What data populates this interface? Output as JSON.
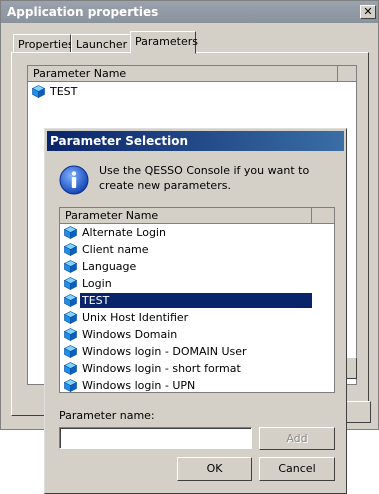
{
  "outer_window": {
    "title": "Application properties",
    "close_glyph": "✕",
    "tabs": [
      {
        "label": "Properties",
        "active": false
      },
      {
        "label": "Launcher",
        "active": false
      },
      {
        "label": "Parameters",
        "active": true
      }
    ],
    "list": {
      "column_header": "Parameter Name",
      "rows": [
        {
          "label": "TEST",
          "icon": "cube-icon"
        }
      ]
    }
  },
  "dialog": {
    "title": "Parameter Selection",
    "info_icon": "info-icon",
    "message": "Use the QESSO Console if you want to create new parameters.",
    "list": {
      "column_header": "Parameter Name",
      "selected_index": 4,
      "items": [
        "Alternate Login",
        "Client name",
        "Language",
        "Login",
        "TEST",
        "Unix Host Identifier",
        "Windows Domain",
        "Windows login - DOMAIN User",
        "Windows login - short format",
        "Windows login - UPN"
      ]
    },
    "name_label": "Parameter name:",
    "name_value": "",
    "add_label": "Add",
    "ok_label": "OK",
    "cancel_label": "Cancel"
  },
  "colors": {
    "selection": "#0a246a",
    "cube_blue": "#1e90ff",
    "dialog_face": "#d4d0c8"
  }
}
